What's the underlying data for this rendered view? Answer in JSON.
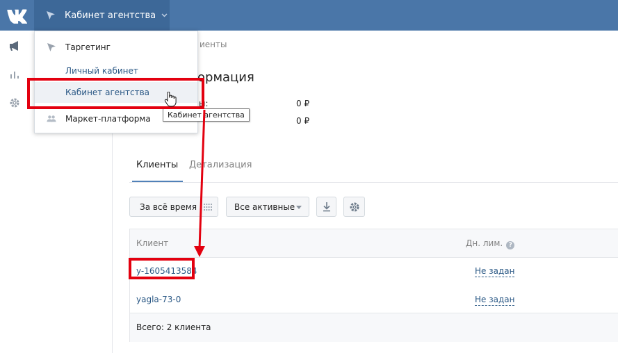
{
  "header": {
    "cabinet_label": "Кабинет агентства"
  },
  "breadcrumb": {
    "text": "иенты"
  },
  "info": {
    "title": "ормация",
    "row1_label": "ы:",
    "row1_value": "0 ₽",
    "row2_value": "0 ₽"
  },
  "tabs": [
    {
      "label": "Клиенты"
    },
    {
      "label": "Детализация"
    }
  ],
  "filters": {
    "period_label": "За всё время",
    "status_label": "Все активные"
  },
  "table": {
    "columns": [
      "Клиент",
      "Дн. лим."
    ],
    "rows": [
      {
        "client": "y-1605413584",
        "limit": "Не задан"
      },
      {
        "client": "yagla-73-0",
        "limit": "Не задан"
      }
    ],
    "footer": "Всего: 2 клиента"
  },
  "menu": {
    "items": [
      {
        "label": "Таргетинг"
      },
      {
        "label": "Личный кабинет"
      },
      {
        "label": "Кабинет агентства"
      },
      {
        "label": "Маркет-платформа"
      }
    ]
  },
  "tooltip": {
    "text": "Кабинет агентства"
  },
  "colors": {
    "header_bg": "#4a76a8",
    "link": "#2a5885",
    "annotation_red": "#e3000f"
  }
}
